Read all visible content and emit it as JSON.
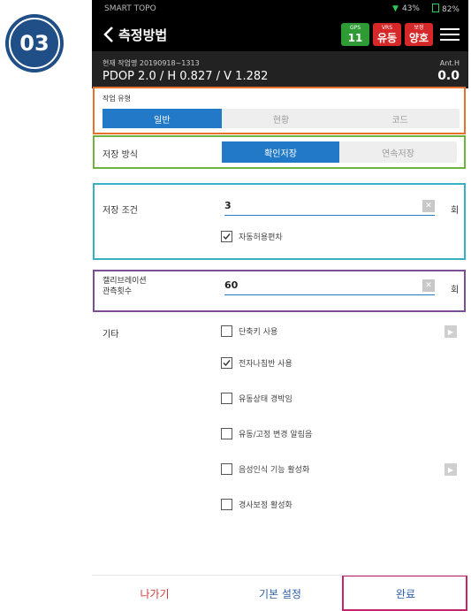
{
  "step_badge": "03",
  "status": {
    "carrier": "SMART TOPO",
    "signal": "43%",
    "battery": "82%"
  },
  "appbar": {
    "title": "측정방법",
    "chips": [
      {
        "top": "GPS",
        "bottom": "11",
        "color": "#2e9b34"
      },
      {
        "top": "VRS",
        "bottom": "유동",
        "color": "#d62828"
      },
      {
        "top": "보정",
        "bottom": "양호",
        "color": "#d62828"
      }
    ]
  },
  "job": {
    "current_job": "현재 작업명 20190918~1313",
    "pdop": "PDOP 2.0 / H 0.827 / V 1.282",
    "ant_label": "Ant.H",
    "ant_value": "0.0"
  },
  "work_type": {
    "label": "작업 유형",
    "options": [
      "일반",
      "현황",
      "코드"
    ],
    "selected": 0
  },
  "save_mode": {
    "label": "저장 방식",
    "options": [
      "확인저장",
      "연속저장"
    ],
    "selected": 0
  },
  "save_condition": {
    "label": "저장 조건",
    "value": "3",
    "unit": "회",
    "checkbox": {
      "label": "자동허용편차",
      "checked": true
    }
  },
  "calibration": {
    "label_line1": "캘리브레이션",
    "label_line2": "관측횟수",
    "value": "60",
    "unit": "회"
  },
  "etc": {
    "label": "기타",
    "items": [
      {
        "label": "단축키 사용",
        "checked": false
      },
      {
        "label": "전자나침반 사용",
        "checked": true
      },
      {
        "label": "유동상태 경박임",
        "checked": false
      },
      {
        "label": "유동/고정 변경 알림음",
        "checked": false
      },
      {
        "label": "음성인식 기능 활성화",
        "checked": false
      },
      {
        "label": "경사보정 활성화",
        "checked": false
      }
    ]
  },
  "bottom": {
    "back": "나가기",
    "default": "기본 설정",
    "done": "완료"
  }
}
